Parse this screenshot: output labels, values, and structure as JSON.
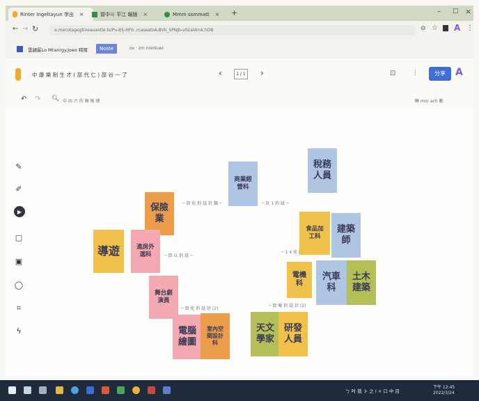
{
  "browser": {
    "tabs": [
      {
        "label": "Rinter Ingeltayun 字出",
        "active": true
      },
      {
        "label": "冒中ㄐ 平江 報版",
        "active": false
      },
      {
        "label": "Mmm ssmmatt",
        "active": false
      }
    ],
    "url": "e.mecotagegtineauaotle.ts/Pu-B5-HFb..rcaseatoA-BVh_SPNJb-v02aldrnk.hDB",
    "bookmarks": [
      {
        "label": "雲韻冕Lo Mtanrgy.Joeo 特周"
      },
      {
        "label": "Noste"
      },
      {
        "label": "ox · zm nrerkuer"
      }
    ]
  },
  "app": {
    "title": "中 康 樂 制 生 才 ( 部 代 仁 ) 部 谷 一 了",
    "page_indicator": "1 / 1",
    "share_label": "分享",
    "toolbar_text": "中 凶 六 的 聯 格 總",
    "right_status": "聯 mor ach 刪"
  },
  "notes": [
    {
      "id": "daoyou",
      "lines": [
        "導遊"
      ],
      "color": "yellow"
    },
    {
      "id": "baoxian",
      "lines": [
        "保險",
        "業"
      ],
      "color": "orange"
    },
    {
      "id": "canyin",
      "lines": [
        "進房外",
        "選科"
      ],
      "color": "pink"
    },
    {
      "id": "wutai",
      "lines": [
        "舞台劇",
        "演員"
      ],
      "color": "pink"
    },
    {
      "id": "diannao",
      "lines": [
        "電腦",
        "繪圖"
      ],
      "color": "pink"
    },
    {
      "id": "shinei",
      "lines": [
        "室內空",
        "間設計",
        "科"
      ],
      "color": "orange"
    },
    {
      "id": "shangye",
      "lines": [
        "商業經",
        "營科"
      ],
      "color": "blue"
    },
    {
      "id": "shuiwu",
      "lines": [
        "稅務",
        "人員"
      ],
      "color": "blue"
    },
    {
      "id": "shipin",
      "lines": [
        "食品加",
        "工科"
      ],
      "color": "yellow"
    },
    {
      "id": "jianzhu",
      "lines": [
        "建築",
        "師"
      ],
      "color": "blue"
    },
    {
      "id": "dianji",
      "lines": [
        "電機",
        "科"
      ],
      "color": "yellow"
    },
    {
      "id": "qiche",
      "lines": [
        "汽車",
        "科"
      ],
      "color": "blue"
    },
    {
      "id": "tumu",
      "lines": [
        "土木",
        "建築"
      ],
      "color": "green"
    },
    {
      "id": "tianwen",
      "lines": [
        "天文",
        "學家"
      ],
      "color": "green"
    },
    {
      "id": "yanfa",
      "lines": [
        "研發",
        "人員"
      ],
      "color": "yellow"
    }
  ],
  "labels": {
    "l1": "─ 目 化 的 話 計 類 ─",
    "l2": "─ 計 1 的 試 ─",
    "l3": "─ 目 以 的 話 ─",
    "l4": "─ 1 4 化 的 ─",
    "l5": "─ 目 化 的 話 計 (2)",
    "l6": "─ 目 報 的 話 計 (2)"
  },
  "taskbar": {
    "tray_text": "ㄅ 吋 我 卜 之 I × 口 中 目",
    "time": "下午 12:45",
    "date": "2022/3/24"
  },
  "colors": {
    "yellow": "#f0c24b",
    "orange": "#ec9d4a",
    "pink": "#f4a8b2",
    "blue": "#aec6e4",
    "green": "#b5bf58",
    "tabbar": "#cfd9c4",
    "taskbar": "#1f2a3a",
    "share": "#3f6fd6",
    "avatar": "#7c5ce0"
  }
}
